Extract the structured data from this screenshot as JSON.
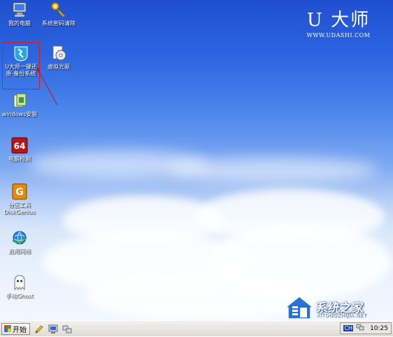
{
  "desktop": {
    "icons": [
      {
        "label": "我的电脑",
        "icon": "my-computer-icon"
      },
      {
        "label": "系统密码清除",
        "icon": "key-icon"
      },
      {
        "label": "U大师一键还原-备份系统",
        "icon": "udashi-restore-icon"
      },
      {
        "label": "虚拟光驱",
        "icon": "virtual-cd-icon"
      },
      {
        "label": "windows安装",
        "icon": "windows-setup-icon"
      },
      {
        "label": "电脑检测",
        "icon": "hardware-check-icon",
        "badge": "64"
      },
      {
        "label": "分区工具",
        "label2": "DiskGenius",
        "icon": "diskgenius-icon"
      },
      {
        "label": "启用网络",
        "icon": "network-icon"
      },
      {
        "label": "手动Ghost",
        "icon": "ghost-icon"
      }
    ]
  },
  "brand": {
    "logo": "U 大师",
    "url": "WWW.UDASHI.COM"
  },
  "watermark": {
    "title": "系统之家",
    "url": "XITONGZHIJIA.NET"
  },
  "taskbar": {
    "start_label": "开始",
    "input_lang": "CH",
    "clock": "10:25"
  },
  "colors": {
    "selection": "#e01818",
    "sky_top": "#1f4fd0",
    "taskbar": "#dedcd4"
  }
}
